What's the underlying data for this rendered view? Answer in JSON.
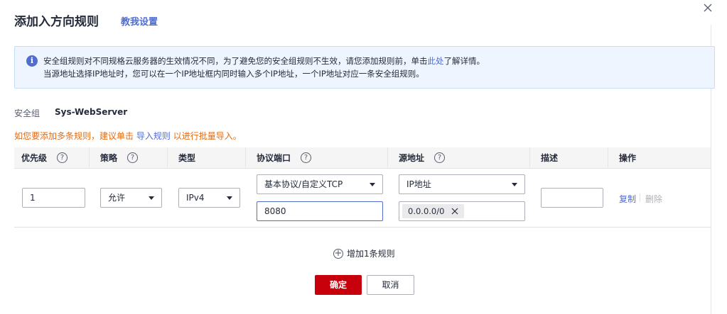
{
  "dialog": {
    "title": "添加入方向规则",
    "help_link": "教我设置"
  },
  "info": {
    "line1_prefix": "安全组规则对不同规格云服务器的生效情况不同，为了避免您的安全组规则不生效，请您添加规则前，单击",
    "line1_link": "此处",
    "line1_suffix": "了解详情。",
    "line2": "当源地址选择IP地址时，您可以在一个IP地址框内同时输入多个IP地址，一个IP地址对应一条安全组规则。"
  },
  "security_group": {
    "label": "安全组",
    "value": "Sys-WebServer"
  },
  "hint": {
    "prefix": "如您要添加多条规则，建议单击",
    "link": "导入规则",
    "suffix": "以进行批量导入。"
  },
  "table": {
    "headers": {
      "priority": "优先级",
      "policy": "策略",
      "type": "类型",
      "protocol_port": "协议端口",
      "source": "源地址",
      "description": "描述",
      "actions": "操作"
    },
    "row": {
      "priority": "1",
      "policy": "允许",
      "type": "IPv4",
      "protocol": "基本协议/自定义TCP",
      "port": "8080",
      "source_type": "IP地址",
      "source_ip": "0.0.0.0/0",
      "description": "",
      "copy": "复制",
      "delete": "删除"
    }
  },
  "add_rule": "增加1条规则",
  "buttons": {
    "ok": "确定",
    "cancel": "取消"
  },
  "colors": {
    "primary": "#c7000b",
    "link": "#526ecc",
    "warning": "#e06c17",
    "info_bg": "#eef5ff"
  }
}
